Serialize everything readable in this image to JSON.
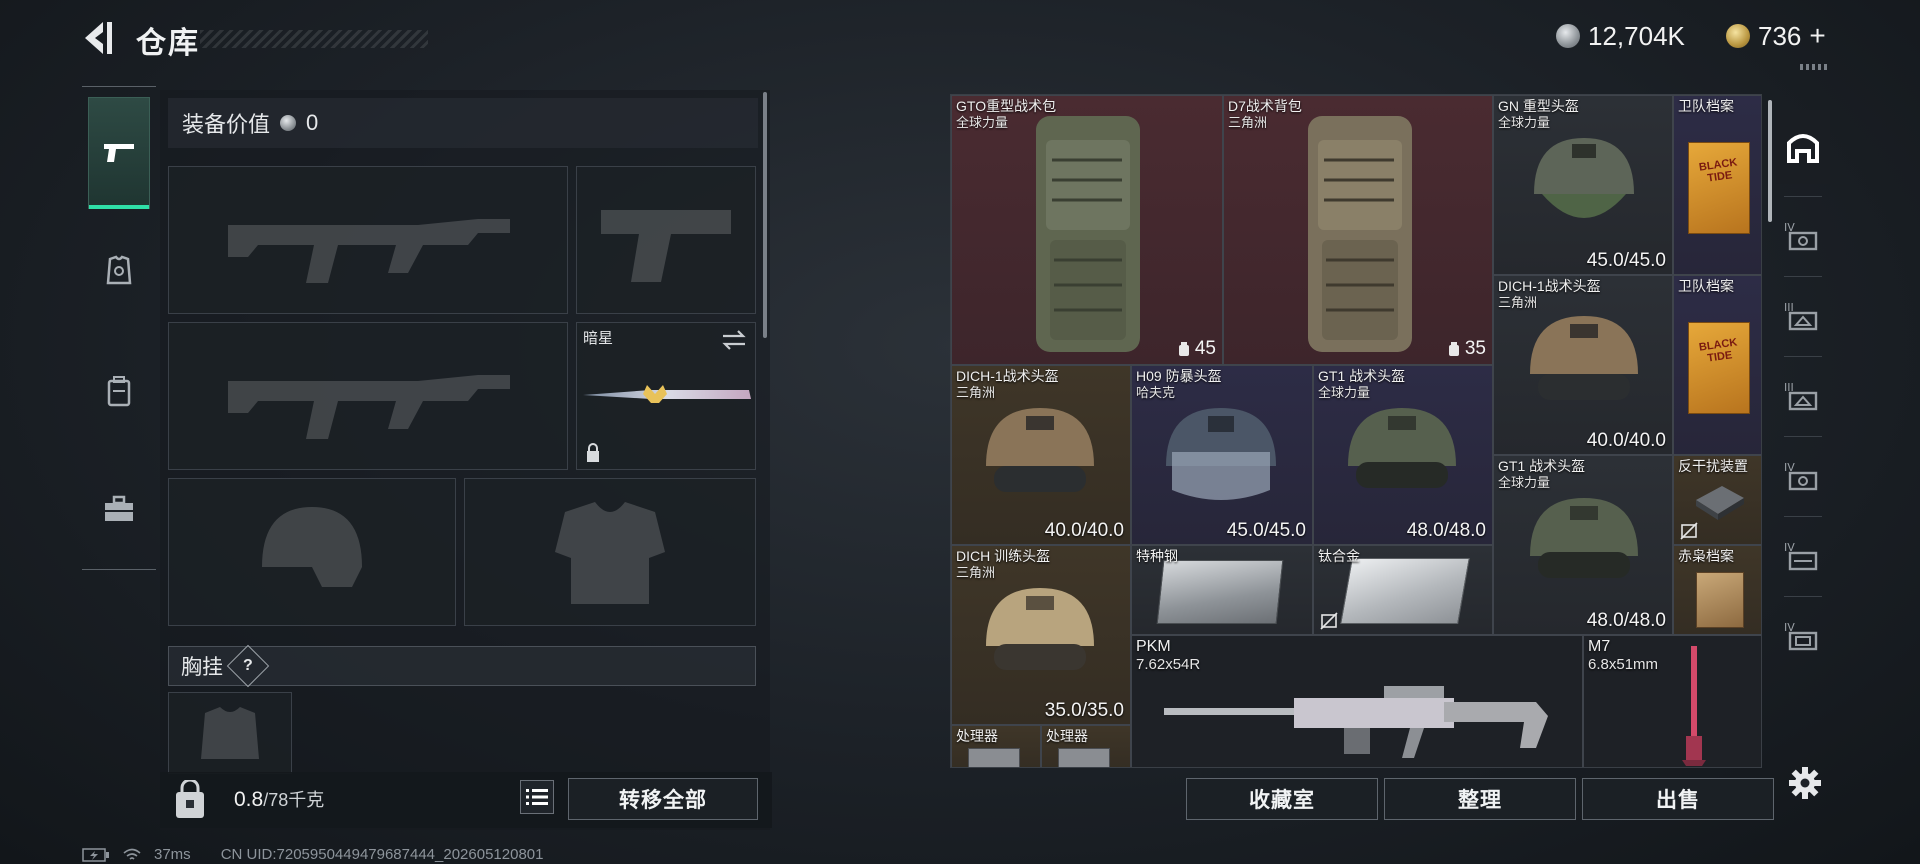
{
  "header": {
    "title": "仓库",
    "currencies": [
      {
        "icon": "silver-coin-icon",
        "value": "12,704K"
      },
      {
        "icon": "gold-coin-icon",
        "value": "736",
        "add": "+"
      }
    ]
  },
  "equipment": {
    "value_label": "装备价值",
    "value": "0",
    "melee": {
      "name": "暗星"
    },
    "chest_label": "胸挂",
    "help": "?"
  },
  "bottom": {
    "weight_current": "0.8",
    "weight_max": "/78千克",
    "transfer_all": "转移全部"
  },
  "actions": {
    "collection": "收藏室",
    "organize": "整理",
    "sell": "出售"
  },
  "status": {
    "ping": "37ms",
    "uid": "CN UID:7205950449479687444_202605120801"
  },
  "items": [
    {
      "name": "GTO重型战术包",
      "sub": "全球力量",
      "badge": "45"
    },
    {
      "name": "D7战术背包",
      "sub": "三角洲",
      "badge": "35"
    },
    {
      "name": "GN 重型头盔",
      "sub": "全球力量",
      "durability": "45.0/45.0"
    },
    {
      "name": "卫队档案",
      "art_text": "BLACK TIDE"
    },
    {
      "name": "DICH-1战术头盔",
      "sub": "三角洲",
      "durability": "40.0/40.0"
    },
    {
      "name": "卫队档案",
      "art_text": "BLACK TIDE"
    },
    {
      "name": "DICH-1战术头盔",
      "sub": "三角洲",
      "durability": "40.0/40.0"
    },
    {
      "name": "H09 防暴头盔",
      "sub": "哈夫克",
      "durability": "45.0/45.0"
    },
    {
      "name": "GT1 战术头盔",
      "sub": "全球力量",
      "durability": "48.0/48.0"
    },
    {
      "name": "GT1 战术头盔",
      "sub": "全球力量",
      "durability": "48.0/48.0"
    },
    {
      "name": "反干扰装置"
    },
    {
      "name": "DICH 训练头盔",
      "sub": "三角洲",
      "durability": "35.0/35.0"
    },
    {
      "name": "特种钢"
    },
    {
      "name": "钛合金"
    },
    {
      "name": "赤枭档案"
    },
    {
      "name": "PKM",
      "sub": "7.62x54R"
    },
    {
      "name": "M7",
      "sub": "6.8x51mm"
    },
    {
      "name": "处理器"
    },
    {
      "name": "处理器"
    }
  ]
}
